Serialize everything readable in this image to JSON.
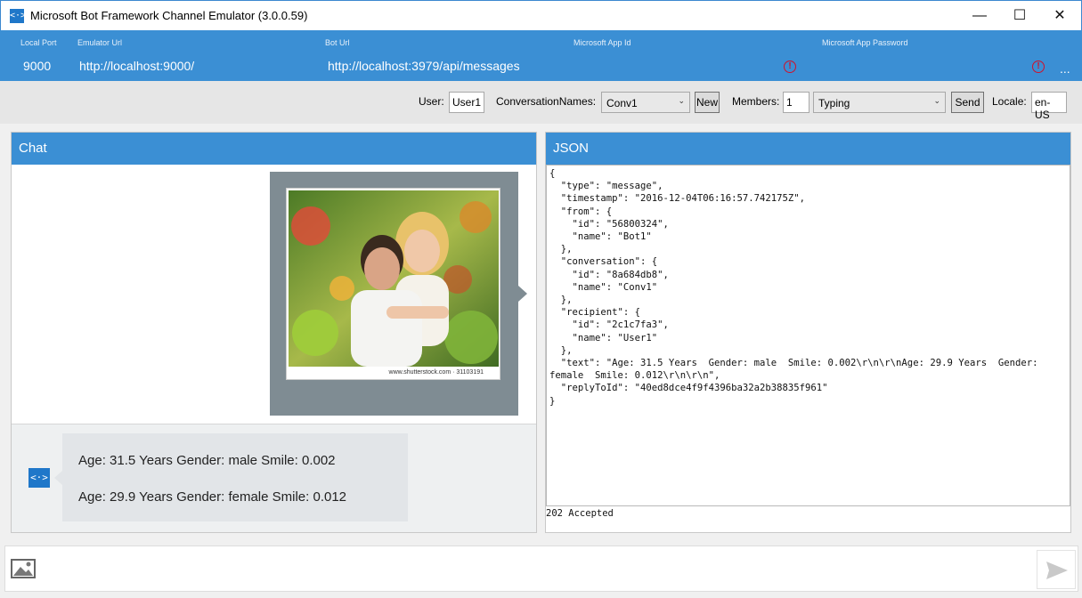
{
  "window": {
    "title": "Microsoft Bot Framework Channel Emulator (3.0.0.59)",
    "minimize": "—",
    "maximize": "☐",
    "close": "✕"
  },
  "infobar": {
    "local_port_label": "Local Port",
    "local_port": "9000",
    "emulator_url_label": "Emulator Url",
    "emulator_url": "http://localhost:9000/",
    "bot_url_label": "Bot Url",
    "bot_url": "http://localhost:3979/api/messages",
    "app_id_label": "Microsoft App Id",
    "app_password_label": "Microsoft App Password",
    "error_glyph": "!",
    "more": "..."
  },
  "toolbar": {
    "user_label": "User:",
    "user_value": "User1",
    "conversation_label": "ConversationNames:",
    "conversation_value": "Conv1",
    "new_button": "New",
    "members_label": "Members:",
    "members_value": "1",
    "activity_value": "Typing",
    "send_button": "Send",
    "locale_label": "Locale:",
    "locale_value": "en-US"
  },
  "chat": {
    "header": "Chat",
    "image_caption": "www.shutterstock.com · 31103191",
    "message_line1": "Age: 31.5 Years Gender: male Smile: 0.002",
    "message_line2": "Age: 29.9 Years Gender: female Smile: 0.012"
  },
  "json_panel": {
    "header": "JSON",
    "content": "{\n  \"type\": \"message\",\n  \"timestamp\": \"2016-12-04T06:16:57.742175Z\",\n  \"from\": {\n    \"id\": \"56800324\",\n    \"name\": \"Bot1\"\n  },\n  \"conversation\": {\n    \"id\": \"8a684db8\",\n    \"name\": \"Conv1\"\n  },\n  \"recipient\": {\n    \"id\": \"2c1c7fa3\",\n    \"name\": \"User1\"\n  },\n  \"text\": \"Age: 31.5 Years  Gender: male  Smile: 0.002\\r\\n\\r\\nAge: 29.9 Years  Gender:\nfemale  Smile: 0.012\\r\\n\\r\\n\",\n  \"replyToId\": \"40ed8dce4f9f4396ba32a2b38835f961\"\n}",
    "status": "202 Accepted"
  },
  "colors": {
    "accent": "#3b8fd4",
    "error": "#d0112b"
  },
  "icons": {
    "app": "bot-emulator-icon",
    "attach": "image-icon",
    "send": "send-icon"
  }
}
